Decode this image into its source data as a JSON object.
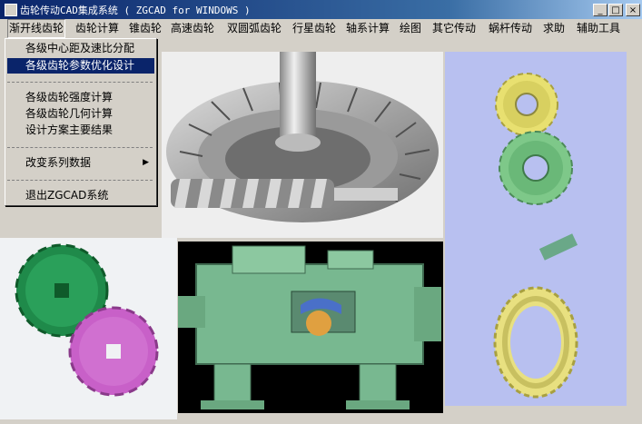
{
  "window": {
    "title": "齿轮传动CAD集成系统 ( ZGCAD for WINDOWS )",
    "buttons": {
      "minimize": "_",
      "maximize": "□",
      "close": "×"
    }
  },
  "menu": {
    "items": [
      "渐开线齿轮",
      "齿轮计算",
      "锥齿轮",
      "高速齿轮",
      "双圆弧齿轮",
      "行星齿轮",
      "轴系计算",
      "绘图",
      "其它传动",
      "蜗杆传动",
      "求助",
      "辅助工具"
    ]
  },
  "dropdown": {
    "items": [
      "各级中心距及速比分配",
      "各级齿轮参数优化设计",
      "各级齿轮强度计算",
      "各级齿轮几何计算",
      "设计方案主要结果",
      "改变系列数据",
      "退出ZGCAD系统"
    ],
    "submenu_arrow": "▶"
  },
  "colors": {
    "title_bar": "#0a246a",
    "selection": "#0a246a",
    "gear_yellow": "#e8e070",
    "gear_green": "#7ec889",
    "gear_dark_green": "#1f8a4a",
    "gear_magenta": "#c860c8",
    "machine_green": "#78b890",
    "right_panel_bg": "#b8c0f0"
  },
  "images": {
    "top_center": "bevel-gear-worm-render",
    "top_right": "two-spur-gears-yellow-green",
    "bottom_left": "spur-gears-green-magenta",
    "bottom_center": "gearbox-cutaway-render",
    "bottom_right": "worm-and-wheel-render"
  }
}
